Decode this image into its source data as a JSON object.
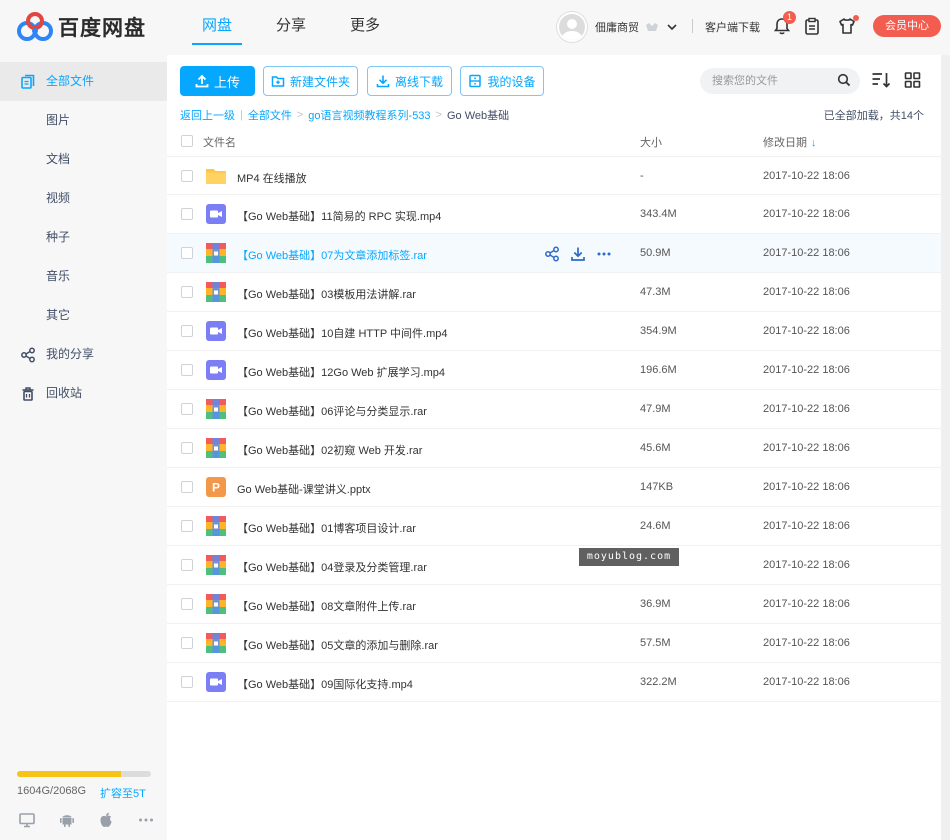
{
  "header": {
    "logo_text": "百度网盘",
    "nav": [
      "网盘",
      "分享",
      "更多"
    ],
    "active_nav": 0,
    "username": "佃庸商贸",
    "client_download": "客户端下载",
    "notifications": "1",
    "vip_button": "会员中心"
  },
  "sidebar": {
    "items": [
      "全部文件",
      "图片",
      "文档",
      "视频",
      "种子",
      "音乐",
      "其它",
      "我的分享",
      "回收站"
    ],
    "active_index": 0,
    "quota": {
      "used_text": "1604G/2068G",
      "used_fraction": 0.776,
      "expand": "扩容至5T"
    }
  },
  "toolbar": {
    "upload": "上传",
    "new_folder": "新建文件夹",
    "offline_download": "离线下载",
    "my_devices": "我的设备",
    "search_placeholder": "搜索您的文件"
  },
  "breadcrumb": {
    "back": "返回上一级",
    "items": [
      "全部文件",
      "go语言视频教程系列-533",
      "Go Web基础"
    ],
    "loaded": "已全部加载，共14个"
  },
  "table": {
    "headers": {
      "name": "文件名",
      "size": "大小",
      "date": "修改日期"
    },
    "sort_arrow": "↓",
    "hover_index": 2,
    "rows": [
      {
        "type": "folder",
        "name": "MP4 在线播放",
        "size": "-",
        "date": "2017-10-22 18:06"
      },
      {
        "type": "video",
        "name": "【Go Web基础】11简易的 RPC 实现.mp4",
        "size": "343.4M",
        "date": "2017-10-22 18:06"
      },
      {
        "type": "rar",
        "name": "【Go Web基础】07为文章添加标签.rar",
        "size": "50.9M",
        "date": "2017-10-22 18:06"
      },
      {
        "type": "rar",
        "name": "【Go Web基础】03模板用法讲解.rar",
        "size": "47.3M",
        "date": "2017-10-22 18:06"
      },
      {
        "type": "video",
        "name": "【Go Web基础】10自建 HTTP 中间件.mp4",
        "size": "354.9M",
        "date": "2017-10-22 18:06"
      },
      {
        "type": "video",
        "name": "【Go Web基础】12Go Web 扩展学习.mp4",
        "size": "196.6M",
        "date": "2017-10-22 18:06"
      },
      {
        "type": "rar",
        "name": "【Go Web基础】06评论与分类显示.rar",
        "size": "47.9M",
        "date": "2017-10-22 18:06"
      },
      {
        "type": "rar",
        "name": "【Go Web基础】02初窥 Web 开发.rar",
        "size": "45.6M",
        "date": "2017-10-22 18:06"
      },
      {
        "type": "ppt",
        "name": "Go Web基础-课堂讲义.pptx",
        "size": "147KB",
        "date": "2017-10-22 18:06"
      },
      {
        "type": "rar",
        "name": "【Go Web基础】01博客项目设计.rar",
        "size": "24.6M",
        "date": "2017-10-22 18:06"
      },
      {
        "type": "rar",
        "name": "【Go Web基础】04登录及分类管理.rar",
        "size": "",
        "date": "2017-10-22 18:06"
      },
      {
        "type": "rar",
        "name": "【Go Web基础】08文章附件上传.rar",
        "size": "36.9M",
        "date": "2017-10-22 18:06"
      },
      {
        "type": "rar",
        "name": "【Go Web基础】05文章的添加与删除.rar",
        "size": "57.5M",
        "date": "2017-10-22 18:06"
      },
      {
        "type": "video",
        "name": "【Go Web基础】09国际化支持.mp4",
        "size": "322.2M",
        "date": "2017-10-22 18:06"
      }
    ]
  },
  "watermark": "moyublog.com",
  "colors": {
    "accent": "#06a7ff",
    "vip": "#f25d50",
    "quota": "#f6c417",
    "folder": "#ffc742",
    "video": "#7b7ef5",
    "ppt": "#f3984a"
  }
}
